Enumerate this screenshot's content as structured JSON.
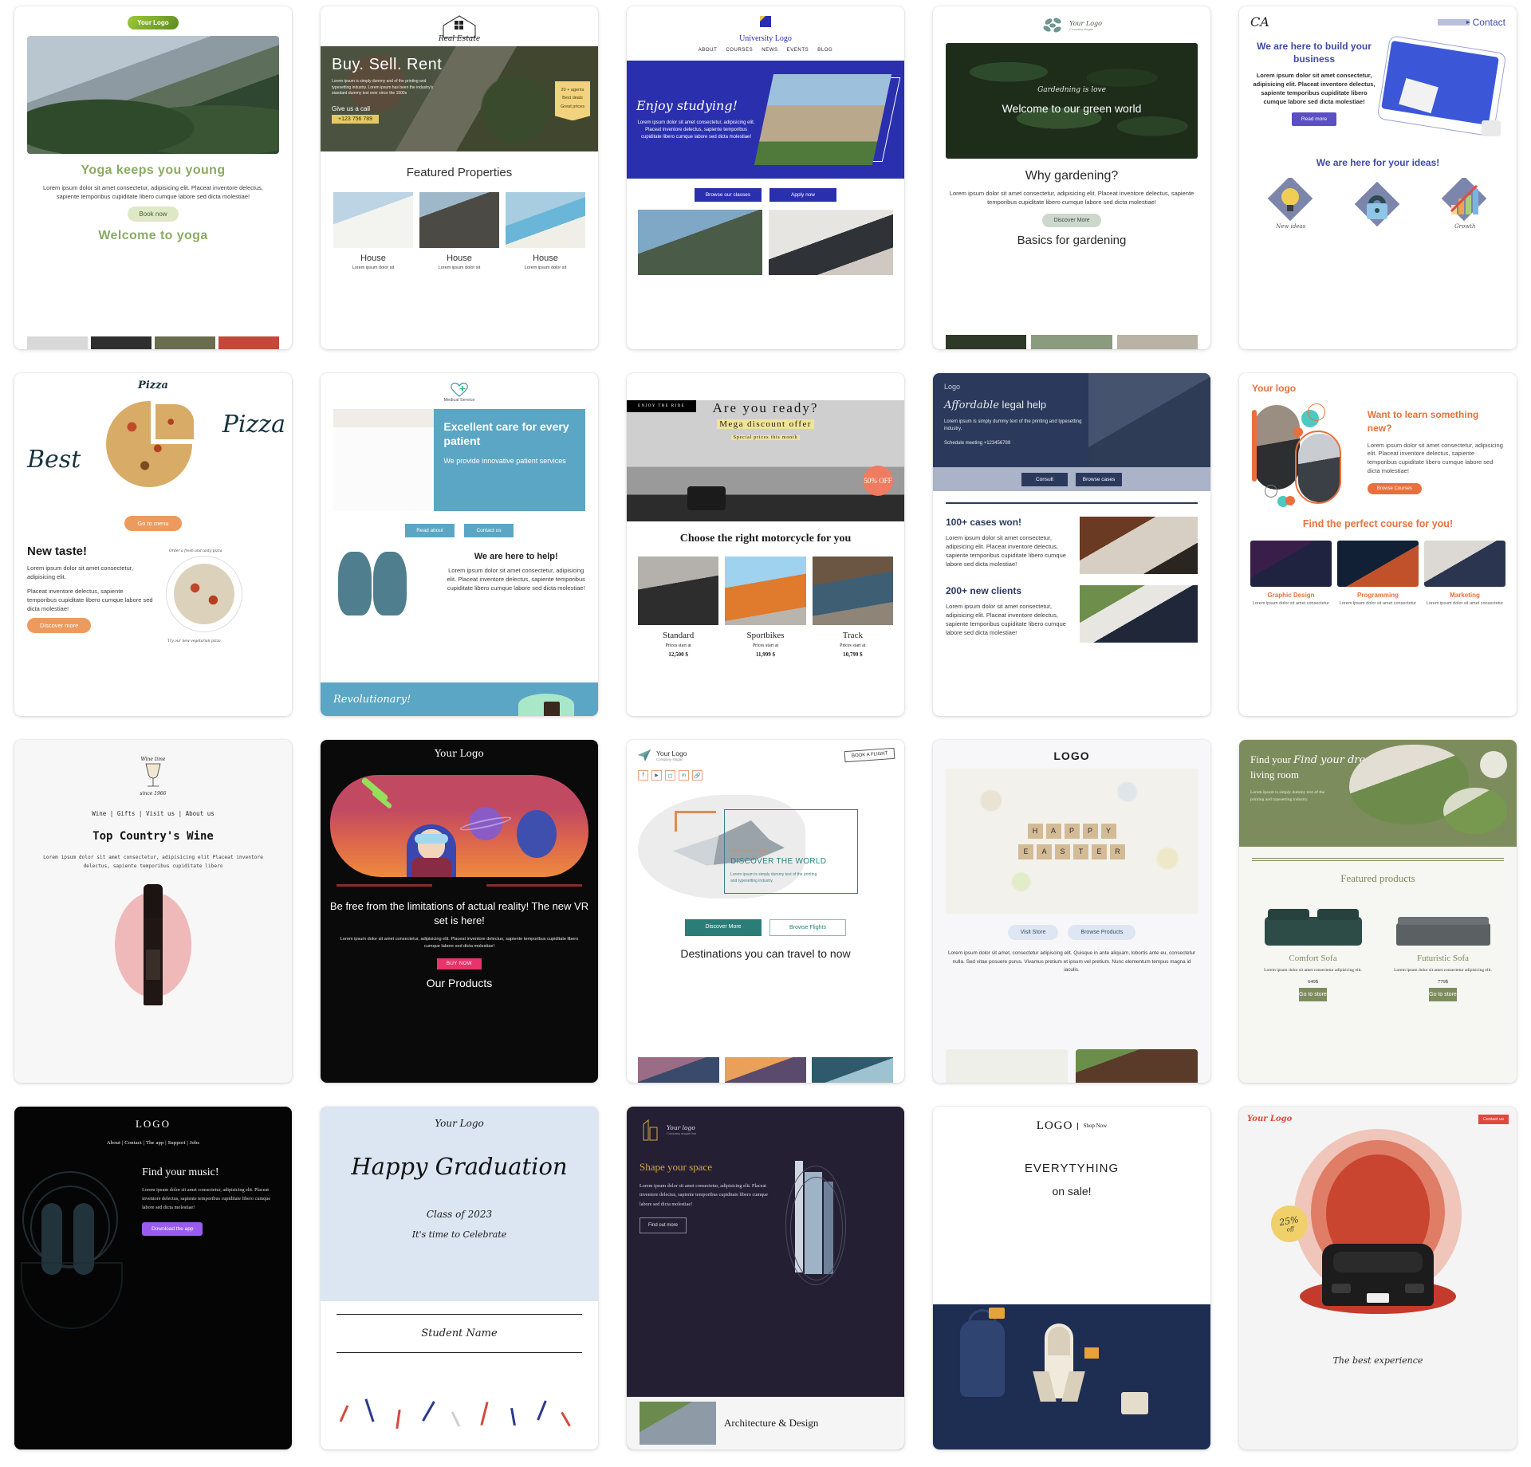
{
  "gallery": {
    "templates": [
      {
        "id": "yoga",
        "logo": "Your Logo",
        "headline": "Yoga keeps you young",
        "body": "Lorem ipsum dolor sit amet consectetur, adipisicing elit. Placeat inventore delectus, sapiente temporibus cupiditate libero cumque labore sed dicta molestiae!",
        "cta": "Book now",
        "section": "Welcome to yoga",
        "accent": "#8aab63"
      },
      {
        "id": "real-estate",
        "logo": "Real Estate",
        "headline": "Buy. Sell. Rent",
        "body": "Lorem ipsum is simply dummy and of the printing and typesetting industry. Lorem ipsum has been the industry's standard dummy text ever since the 1500s",
        "call_label": "Give us a call",
        "phone": "+123 756 789",
        "badge": [
          "20 + agents",
          "Best deals",
          "Great prices"
        ],
        "section": "Featured Properties",
        "products": [
          {
            "name": "House",
            "desc": "Lorem ipsum dolor sit"
          },
          {
            "name": "House",
            "desc": "Lorem ipsum dolor sit"
          },
          {
            "name": "House",
            "desc": "Lorem ipsum dolor sit"
          }
        ]
      },
      {
        "id": "university",
        "logo": "University Logo",
        "nav": [
          "ABOUT",
          "COURSES",
          "NEWS",
          "EVENTS",
          "BLOG"
        ],
        "headline": "Enjoy studying!",
        "body": "Lorem ipsum dolor sit amet consectetur, adipisicing elit. Placeat inventore delectus, sapiente temporibus cupiditate libero cumque labore sed dicta molestiae!",
        "cta_primary": "Browse our classes",
        "cta_secondary": "Apply now",
        "accent": "#2a2fae"
      },
      {
        "id": "gardening",
        "logo": "Your Logo",
        "logo_slogan": "Company slogan",
        "script": "Gardedning is love",
        "hero": "Welcome to our green world",
        "headline": "Why gardening?",
        "body": "Lorem ipsum dolor sit amet consectetur, adipisicing elit. Placeat inventore delectus, sapiente temporibus cupiditate libero cumque labore sed dicta molestiae!",
        "cta": "Discover More",
        "section": "Basics for gardening"
      },
      {
        "id": "ca-business",
        "logo": "CA",
        "contact": "Contact",
        "headline": "We are here to build your business",
        "body": "Lorem ipsum dolor sit amet consectetur, adipisicing elit. Placeat inventore delectus, sapiente temporibus cupiditate libero cumque labore sed dicta molestiae!",
        "cta": "Read more",
        "section": "We are here for your ideas!",
        "icons": [
          {
            "label": "New ideas",
            "icon": "lightbulb-icon"
          },
          {
            "label": "",
            "icon": "lock-icon"
          },
          {
            "label": "Growth",
            "icon": "bar-chart-icon"
          }
        ]
      },
      {
        "id": "pizza",
        "logo": "Pizza",
        "word_left": "Best",
        "word_right": "Pizza",
        "cta_top": "Go to menu",
        "headline": "New taste!",
        "body1": "Lorem ipsum dolor sit amet consectetur, adipisicing elit.",
        "body2": "Placeat inventore delectus, sapiente temporibus cupiditate libero cumque labore sed dicta molestiae!",
        "cta": "Discover more",
        "circle_top": "Order a fresh and tasty pizza",
        "circle_bottom": "Try our new vegetarian pizza"
      },
      {
        "id": "medical",
        "logo": "Medical Service",
        "headline": "Excellent care for every patient",
        "subhead": "We provide innovative patient services",
        "cta_primary": "Read about",
        "cta_secondary": "Contact us",
        "section": "We are here to help!",
        "body": "Lorem ipsum dolor sit amet consectetur, adipisicing elit. Placeat inventore delectus, sapiente temporibus cupiditate libero cumque labore sed dicta molestiae!",
        "footer": "Revolutionary!"
      },
      {
        "id": "motorcycle",
        "tag": "ENJOY THE RIDE",
        "headline": "Are you ready?",
        "subhead": "Mega discount offer",
        "note": "Special prices this month",
        "badge": "50% OFF",
        "section": "Choose the right motorcycle for you",
        "products": [
          {
            "name": "Standard",
            "label": "Prices start at",
            "price": "12,500 $"
          },
          {
            "name": "Sportbikes",
            "label": "Prices start at",
            "price": "11,999 $"
          },
          {
            "name": "Track",
            "label": "Prices start at",
            "price": "10,799 $"
          }
        ]
      },
      {
        "id": "legal",
        "logo": "Logo",
        "headline_italic": "Affordable",
        "headline_rest": " legal help",
        "body": "Lorem ipsum is simply dummy text of the printing and typesetting industry.",
        "schedule": "Schedule meeting +123456789",
        "cta_primary": "Consult",
        "cta_secondary": "Browse cases",
        "stats": [
          {
            "title": "100+ cases won!",
            "body": "Lorem ipsum dolor sit amet consectetur, adipisicing elit. Placeat inventore delectus, sapiente temporibus cupiditate libero cumque labore sed dicta molestiae!"
          },
          {
            "title": "200+ new clients",
            "body": "Lorem ipsum dolor sit amet consectetur, adipisicing elit. Placeat inventore delectus, sapiente temporibus cupiditate libero cumque labore sed dicta molestiae!"
          }
        ]
      },
      {
        "id": "courses",
        "logo": "Your logo",
        "headline": "Want to learn something new?",
        "body": "Lorem ipsum dolor sit amet consectetur, adipisicing elit. Placeat inventore delectus, sapiente temporibus cupiditate libero cumque labore sed dicta molestiae!",
        "cta": "Browse Courses",
        "section": "Find the perfect course for you!",
        "products": [
          {
            "name": "Graphic Design",
            "desc": "Lorem ipsum dolor sit amet consectetur"
          },
          {
            "name": "Programming",
            "desc": "Lorem ipsum dolor sit amet consectetur"
          },
          {
            "name": "Marketing",
            "desc": "Lorem ipsum dolor sit amet consectetur"
          }
        ]
      },
      {
        "id": "wine",
        "logo_top": "Wine time",
        "logo_bottom": "since 1966",
        "nav": [
          "Wine",
          "Gifts",
          "Visit us",
          "About us"
        ],
        "headline": "Top Country's Wine",
        "body": "Lorem ipsum dolor sit amet consectetur, adipisicing elit Placeat inventore delectus, sapiente temporibus cupiditate libero"
      },
      {
        "id": "vr",
        "logo": "Your Logo",
        "headline": "Be free from the limitations of actual reality! The new VR set is here!",
        "body": "Lorem ipsum dolor sit amet consectetur, adipisicing elit. Placeat inventore delectus, sapiente temporibus cupiditate libero cumque labore sed dicta molestiae!",
        "cta": "BUY NOW",
        "section": "Our Products"
      },
      {
        "id": "travel",
        "logo": "Your Logo",
        "logo_slogan": "Company slogan",
        "book_label": "BOOK A FLIGHT",
        "social": [
          "facebook-icon",
          "youtube-icon",
          "instagram-icon",
          "linkedin-icon",
          "link-icon"
        ],
        "kicker": "NEW HORIZONS",
        "headline": "DISCOVER THE WORLD",
        "body": "Lorem ipsum is simply dummy text of the printing and typesetting industry.",
        "cta_primary": "Discover More",
        "cta_secondary": "Browse Flights",
        "section": "Destinations you can travel to now"
      },
      {
        "id": "easter",
        "logo": "LOGO",
        "hero_top": "HAPPY",
        "hero_bottom": "EASTER",
        "cta_primary": "Visit Store",
        "cta_secondary": "Browse Products",
        "body": "Lorem ipsum dolor sit amet, consectetur adipiscing elit. Quisque in ante aliquam, lobortis ante eu, consectetur nulla. Sed vitae posuere purus. Vivamus pretium et ipsum vel pretium. Nunc elementum tempus magna id iaculis."
      },
      {
        "id": "furniture",
        "headline_italic": "Find your dream",
        "headline_rest": "living room",
        "body": "Lorem Ipsum is simply dummy text of the printing and typesetting industry.",
        "section": "Featured products",
        "products": [
          {
            "name": "Comfort Sofa",
            "desc": "Lorem ipsum dolor sit amet consectetur adipisicing elit.",
            "price": "649$",
            "cta": "Go to store"
          },
          {
            "name": "Futuristic Sofa",
            "desc": "Lorem ipsum dolor sit amet consectetur adipisicing elit.",
            "price": "779$",
            "cta": "Go to store"
          }
        ]
      },
      {
        "id": "music",
        "logo": "LOGO",
        "nav": [
          "About",
          "Contact",
          "The app",
          "Support",
          "Jobs"
        ],
        "headline": "Find your music!",
        "body": "Lorem ipsum dolor sit amet consectetur, adipisicing elit. Placeat inventore delectus, sapiente temporibus cupiditate libero cumque labore sed dicta molestiae!",
        "cta": "Download the app"
      },
      {
        "id": "graduation",
        "logo": "Your Logo",
        "headline": "Happy Graduation",
        "line1": "Class of 2023",
        "line2": "It's time to Celebrate",
        "field": "Student Name"
      },
      {
        "id": "architecture",
        "logo": "Your logo",
        "logo_slogan": "Company slogan line",
        "headline": "Shape your space",
        "body": "Lorem ipsum dolor sit amet consectetur, adipisicing elit. Placeat inventore delectus, sapiente temporibus cupiditate libero cumque labore sed dicta molestiae!",
        "cta": "Find out more",
        "section": "Architecture & Design"
      },
      {
        "id": "shop",
        "logo": "LOGO",
        "logo_sub": "Shop Now",
        "headline_top": "EVERYTYHING",
        "headline_bottom": "on sale!"
      },
      {
        "id": "car",
        "logo": "Your Logo",
        "contact": "Contact us",
        "badge_pct": "25%",
        "badge_off": "off",
        "section": "The best experience"
      }
    ]
  }
}
